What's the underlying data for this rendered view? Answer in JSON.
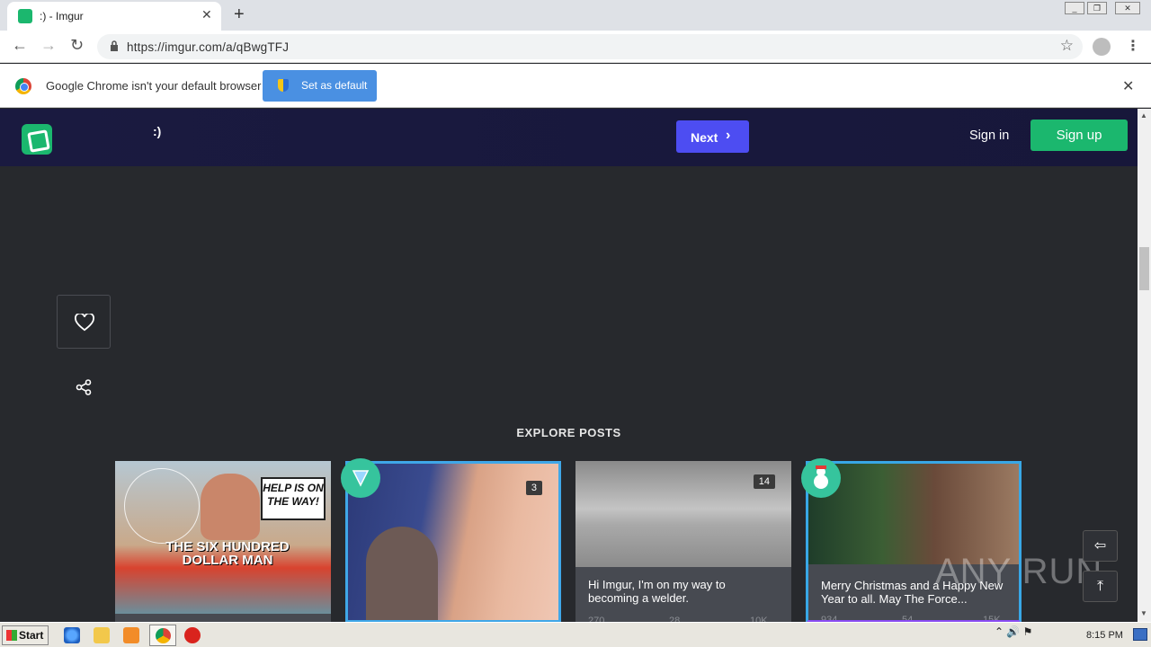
{
  "browser": {
    "tab_title": ":) - Imgur",
    "tab_close": "✕",
    "new_tab": "+",
    "url": "https://imgur.com/a/qBwgTFJ",
    "infobar_text": "Google Chrome isn't your default browser",
    "set_default_label": "Set as default",
    "infobar_close": "✕"
  },
  "imgur": {
    "post_title": ":)",
    "next_label": "Next",
    "next_chevron": "›",
    "sign_in": "Sign in",
    "sign_up": "Sign up",
    "explore_heading": "EXPLORE POSTS",
    "brand_color": "#1bb76e",
    "next_color": "#4d4df2"
  },
  "cards": [
    {
      "title": "",
      "caption_top": "HELP IS ON THE WAY!",
      "caption_bottom": "THE SIX HUNDRED DOLLAR MAN",
      "count": "",
      "stats": [
        "",
        "",
        ""
      ]
    },
    {
      "title": "",
      "count": "3",
      "stats": [
        "",
        "",
        ""
      ]
    },
    {
      "title": "Hi Imgur, I'm on my way to becoming a welder.",
      "count": "14",
      "stats": [
        "270",
        "28",
        "10K"
      ]
    },
    {
      "title": "Merry Christmas and a Happy New Year to all. May The Force...",
      "count": "",
      "stats": [
        "934",
        "54",
        "15K"
      ]
    }
  ],
  "watermark": "ANY RUN",
  "taskbar": {
    "start_label": "Start",
    "clock": "8:15 PM"
  }
}
